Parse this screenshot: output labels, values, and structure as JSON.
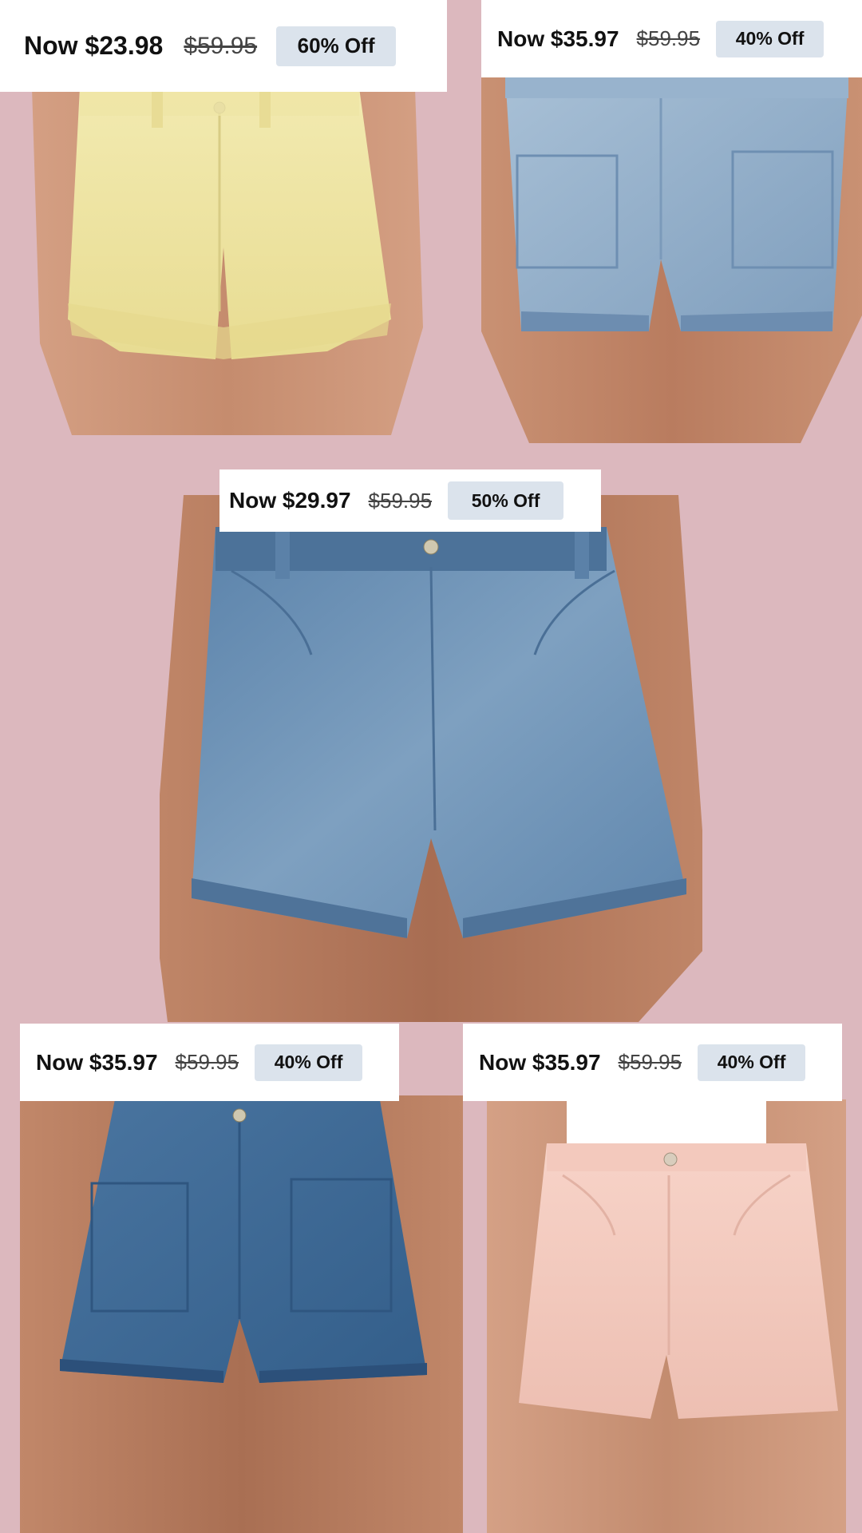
{
  "products": [
    {
      "now_price": "Now $23.98",
      "original_price": "$59.95",
      "discount": "60% Off",
      "denim_color": "#efe6a6"
    },
    {
      "now_price": "Now $35.97",
      "original_price": "$59.95",
      "discount": "40% Off",
      "denim_color": "#8aa8c4"
    },
    {
      "now_price": "Now $29.97",
      "original_price": "$59.95",
      "discount": "50% Off",
      "denim_color": "#6b8fb2"
    },
    {
      "now_price": "Now $35.97",
      "original_price": "$59.95",
      "discount": "40% Off",
      "denim_color": "#3f6a98"
    },
    {
      "now_price": "Now $35.97",
      "original_price": "$59.95",
      "discount": "40% Off",
      "denim_color": "#f2c7bc"
    }
  ],
  "theme": {
    "background": "#dcb8be",
    "discount_badge": "#dbe3ec"
  }
}
